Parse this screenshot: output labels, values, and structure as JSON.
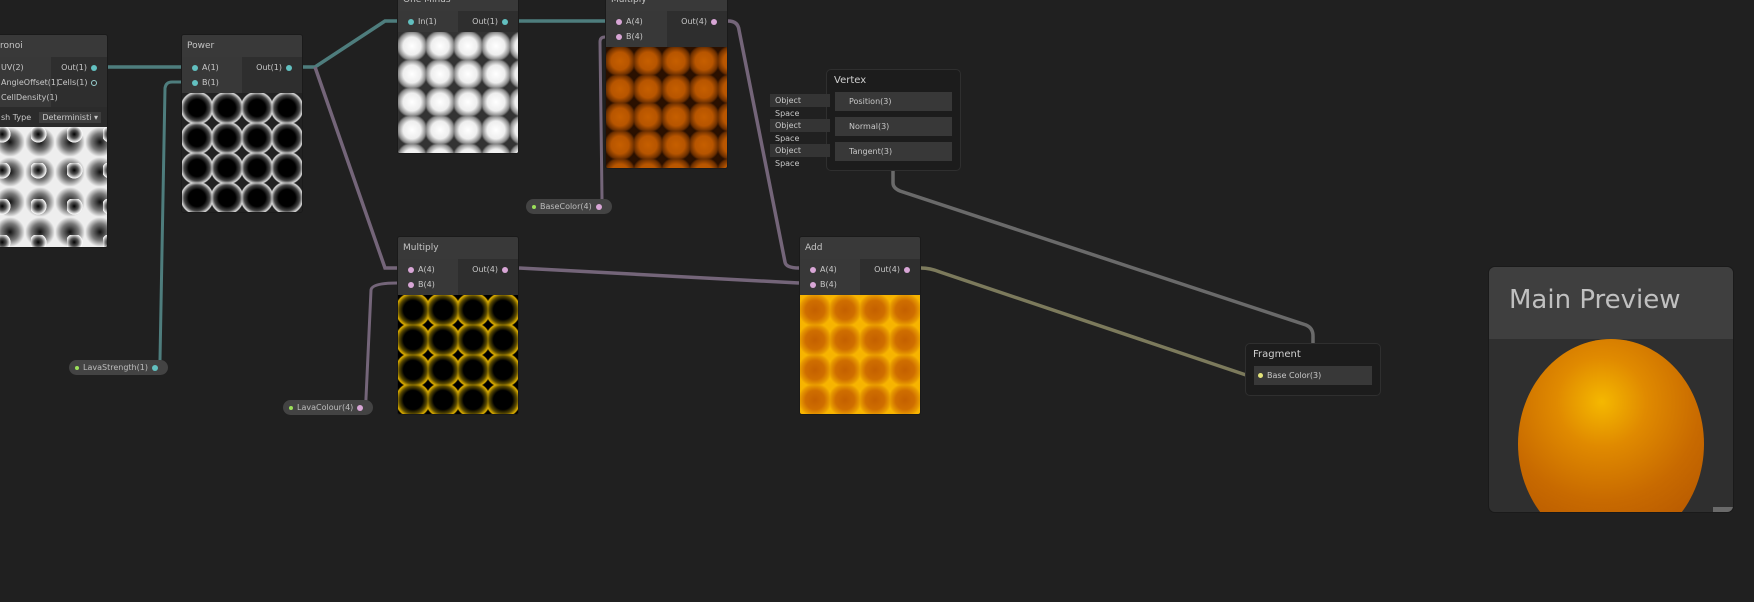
{
  "nodes": {
    "voronoi": {
      "title": "ronoi",
      "inputs": [
        "UV(2)",
        "AngleOffset(1)",
        "CellDensity(1)"
      ],
      "outputs": [
        "Out(1)",
        "Cells(1)"
      ],
      "hash_label": "sh Type",
      "hash_value": "Deterministi"
    },
    "power": {
      "title": "Power",
      "inputs": [
        "A(1)",
        "B(1)"
      ],
      "outputs": [
        "Out(1)"
      ]
    },
    "one_minus": {
      "title": "One Minus",
      "inputs": [
        "In(1)"
      ],
      "outputs": [
        "Out(1)"
      ]
    },
    "multiply_top": {
      "title": "Multiply",
      "inputs": [
        "A(4)",
        "B(4)"
      ],
      "outputs": [
        "Out(4)"
      ]
    },
    "multiply_bottom": {
      "title": "Multiply",
      "inputs": [
        "A(4)",
        "B(4)"
      ],
      "outputs": [
        "Out(4)"
      ]
    },
    "add": {
      "title": "Add",
      "inputs": [
        "A(4)",
        "B(4)"
      ],
      "outputs": [
        "Out(4)"
      ]
    }
  },
  "properties": {
    "base_color": "BaseColor(4)",
    "lava_strength": "LavaStrength(1)",
    "lava_colour": "LavaColour(4)"
  },
  "vertex": {
    "title": "Vertex",
    "rows": [
      {
        "space": "Object Space",
        "label": "Position(3)"
      },
      {
        "space": "Object Space",
        "label": "Normal(3)"
      },
      {
        "space": "Object Space",
        "label": "Tangent(3)"
      }
    ]
  },
  "fragment": {
    "title": "Fragment",
    "rows": [
      "Base Color(3)"
    ]
  },
  "main_preview": {
    "title": "Main Preview"
  },
  "colors": {
    "float_wire": "#4f7f7f",
    "vector_wire": "#7a6a80",
    "vector3_wire": "#7a7a55"
  }
}
